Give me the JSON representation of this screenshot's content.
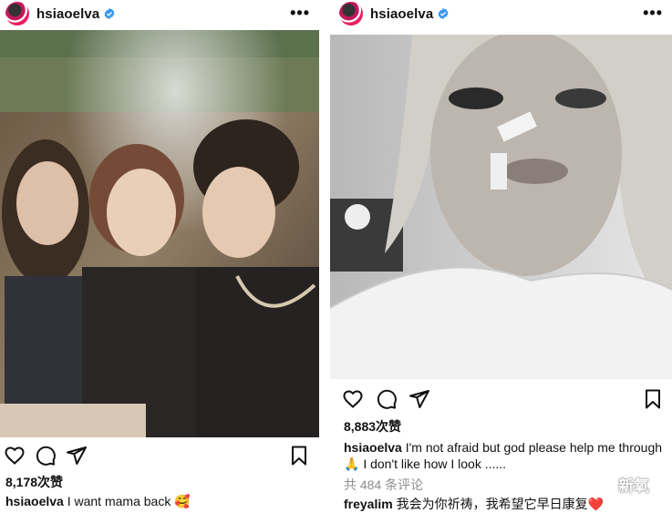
{
  "left_post": {
    "username": "hsiaoelva",
    "likes": "8,178次赞",
    "caption_user": "hsiaoelva",
    "caption_text": "I want mama back 🥰"
  },
  "right_post": {
    "username": "hsiaoelva",
    "likes": "8,883次赞",
    "caption_user": "hsiaoelva",
    "caption_text": "I'm not afraid but god please help me through 🙏 I don't like how I look ......",
    "comments_count": "共 484 条评论",
    "comment_user": "freyalim",
    "comment_text": "我会为你祈祷，我希望它早日康复❤️"
  },
  "watermark": {
    "label": "新氧"
  },
  "icons": {
    "more": "⋯",
    "heart": "heart-icon",
    "comment": "comment-icon",
    "share": "send-icon",
    "save": "bookmark-icon",
    "verified": "verified-badge-icon"
  },
  "colors": {
    "verified_blue": "#3897f0",
    "muted_text": "#8e8e8e"
  }
}
